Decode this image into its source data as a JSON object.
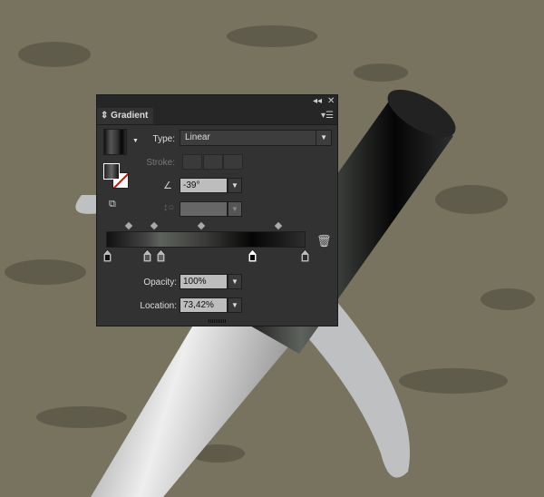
{
  "panel": {
    "tab_label": "Gradient",
    "collapse_icon": "double-chevron-left-icon",
    "close_icon": "close-icon",
    "menu_icon": "panel-menu-icon"
  },
  "type": {
    "label": "Type:",
    "value": "Linear"
  },
  "stroke": {
    "label": "Stroke:"
  },
  "angle": {
    "value": "-39°"
  },
  "aspect": {
    "value": ""
  },
  "opacity": {
    "label": "Opacity:",
    "value": "100%"
  },
  "location": {
    "label": "Location:",
    "value": "73,42%"
  },
  "gradient": {
    "stops": [
      {
        "location": 0,
        "color": "#111111"
      },
      {
        "location": 20,
        "color": "#555555"
      },
      {
        "location": 27,
        "color": "#5e625c"
      },
      {
        "location": 73.42,
        "color": "#050505",
        "selected": true
      },
      {
        "location": 100,
        "color": "#2d2d2d"
      }
    ]
  },
  "colors": {
    "background": "#78735f",
    "panel": "#323232"
  }
}
